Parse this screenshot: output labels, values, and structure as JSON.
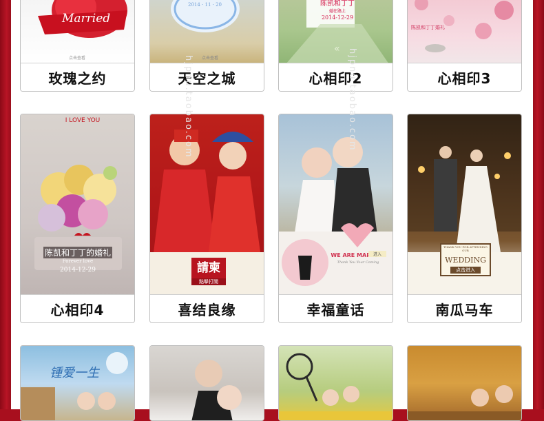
{
  "templates": [
    {
      "name": "玫瑰之约",
      "overlay": "Married",
      "footer": "点击查看"
    },
    {
      "name": "天空之城",
      "overlay": "2014 · 11 · 20",
      "footer": "点击查看"
    },
    {
      "name": "心相印2",
      "overlay_line1": "陈凯和丁丁",
      "overlay_line2": "婚在路上",
      "overlay_date": "2014-12-29"
    },
    {
      "name": "心相印3",
      "overlay": "陈凯和丁丁婚礼"
    },
    {
      "name": "心相印4",
      "banner": "I LOVE YOU",
      "overlay_line1": "陈凯和丁丁的婚礼",
      "overlay_line2": "Forever love",
      "overlay_date": "2014-12-29"
    },
    {
      "name": "喜结良缘",
      "overlay": "請柬",
      "sub": "點擊打開"
    },
    {
      "name": "幸福童话",
      "overlay": "WE ARE MARRIED",
      "sub": "Thank You Your Coming",
      "tag": "进入"
    },
    {
      "name": "南瓜马车",
      "overlay_line1": "THANK YOU FOR ATTENDING OUR",
      "overlay": "WEDDING",
      "sub": "点击进入"
    },
    {
      "name": "",
      "overlay": "锺爱一生"
    },
    {
      "name": ""
    },
    {
      "name": ""
    },
    {
      "name": ""
    }
  ],
  "watermark": "hjpnu.taobao.com"
}
